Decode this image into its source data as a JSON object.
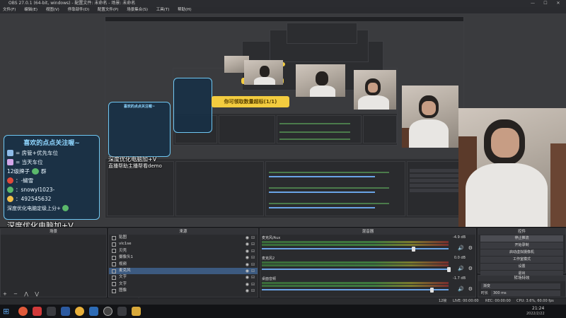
{
  "window": {
    "title": "OBS 27.0.1 (64-bit, windows) - 配置文件: 未命名 - 场景: 未命名",
    "min": "—",
    "max": "☐",
    "close": "✕"
  },
  "menu": [
    "文件(F)",
    "编辑(E)",
    "视图(V)",
    "停靠部件(D)",
    "配置文件(P)",
    "场景集合(S)",
    "工具(T)",
    "帮助(H)"
  ],
  "overlay": {
    "card_title": "喜欢的点点关注喔~",
    "lines": [
      "= 房管+优先车位",
      "= 当天车位",
      "12级牌子",
      "群",
      "：-蝴雪",
      "：snowyl1023-",
      "：492545632",
      "深度优化电脑定级上分+"
    ],
    "banner_text": "你可领取数量超标(1/1)",
    "promo_line1": "深度优化电脑加+V",
    "promo_line2": "直播帮助主播帮看demo"
  },
  "docks": {
    "scenes": "场景",
    "sources": "来源",
    "mixer": "混音器",
    "controls": "控件",
    "transitions": "转场特效"
  },
  "sources": [
    "贴图",
    "vlc1se",
    "贝壳",
    "摄像头1",
    "视频",
    "麦克风",
    "文字",
    "文字",
    "图像",
    "音频"
  ],
  "mixer": [
    {
      "name": "麦克风/Aux",
      "value": "-4.9 dB"
    },
    {
      "name": "麦克风2",
      "value": "0.0 dB"
    },
    {
      "name": "桌面音频",
      "value": "-1.7 dB"
    }
  ],
  "controls": [
    "停止推流",
    "开始录制",
    "启动虚拟摄像机",
    "工作室模式",
    "设置",
    "退出"
  ],
  "transition": {
    "type": "渐变",
    "duration_label": "时长",
    "duration": "300 ms"
  },
  "status": {
    "live": "LIVE: 00:00:00",
    "rec": "REC: 00:00:00",
    "cpu": "CPU: 3.6%, 60.00 fps",
    "dropped": "12帧"
  },
  "taskbar": {
    "time": "21:24",
    "date": "2022/2/22"
  }
}
